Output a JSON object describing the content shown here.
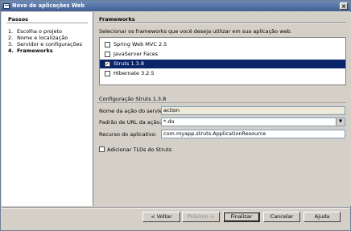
{
  "window": {
    "title": "Novo de aplicações Web"
  },
  "steps": {
    "title": "Passos",
    "items": [
      {
        "num": "1.",
        "label": "Escolha o projeto",
        "current": false
      },
      {
        "num": "2.",
        "label": "Nome e localização",
        "current": false
      },
      {
        "num": "3.",
        "label": "Servidor e configurações",
        "current": false
      },
      {
        "num": "4.",
        "label": "Frameworks",
        "current": true
      }
    ]
  },
  "main": {
    "title": "Frameworks",
    "instruction": "Selecionar os frameworks que você deseja utilizar em sua aplicação web.",
    "frameworks": [
      {
        "label": "Spring Web MVC 2.5",
        "checked": false,
        "selected": false
      },
      {
        "label": "JavaServer Faces",
        "checked": false,
        "selected": false
      },
      {
        "label": "Struts 1.3.8",
        "checked": true,
        "selected": true
      },
      {
        "label": "Hibernate 3.2.5",
        "checked": false,
        "selected": false
      }
    ],
    "config": {
      "title": "Configuração Struts 1.3.8",
      "servlet_label": "Nome da ação do servlet:",
      "servlet_value": "action",
      "url_pattern_label": "Padrão de URL da ação:",
      "url_pattern_value": "*.do",
      "resource_label": "Recurso do aplicativo:",
      "resource_value": "com.myapp.struts.ApplicationResource",
      "tld_label": "Adicionar TLDs do Struts",
      "tld_checked": false
    }
  },
  "buttons": {
    "back": "< Voltar",
    "next": "Próximo >",
    "finish": "Finalizar",
    "cancel": "Cancelar",
    "help": "Ajuda"
  },
  "colors": {
    "title_bar": "#3f5f94",
    "selection": "#0a246a",
    "face": "#d4d0c8"
  }
}
